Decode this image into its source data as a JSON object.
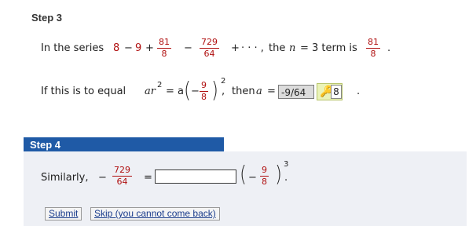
{
  "step3": {
    "title": "Step 3",
    "line1": {
      "prefix": "In the series",
      "t1": "8",
      "minus1": "−",
      "t2": "9",
      "plus1": "+",
      "f1": {
        "num": "81",
        "den": "8"
      },
      "minus2": "−",
      "f2": {
        "num": "729",
        "den": "64"
      },
      "plus2": "+",
      "ellipsis": "· · · ,",
      "then_the": "the",
      "n_var": "n",
      "eq": "= 3 term is",
      "f3": {
        "num": "81",
        "den": "8"
      },
      "period": "."
    },
    "line2": {
      "prefix": "If this is to equal",
      "ar": "ar",
      "ar_exp": "2",
      "eq_a": "= a",
      "inner_minus": "−",
      "f": {
        "num": "9",
        "den": "8"
      },
      "exp": "2",
      "comma": ",",
      "then": "then",
      "a_var": "a",
      "eq": "=",
      "answer": "-9/64",
      "key_value": "8",
      "period": "."
    }
  },
  "step4": {
    "title": "Step 4",
    "line": {
      "prefix": "Similarly,",
      "minus": "−",
      "f": {
        "num": "729",
        "den": "64"
      },
      "eq": "=",
      "input_value": "",
      "inner_minus": "−",
      "f2": {
        "num": "9",
        "den": "8"
      },
      "exp": "3",
      "period": "."
    },
    "submit_label": "Submit",
    "skip_label": "Skip (you cannot come back)"
  },
  "colors": {
    "accent_header": "#1f5aa6",
    "fraction_red": "#b01010",
    "panel": "#eef0f5"
  }
}
